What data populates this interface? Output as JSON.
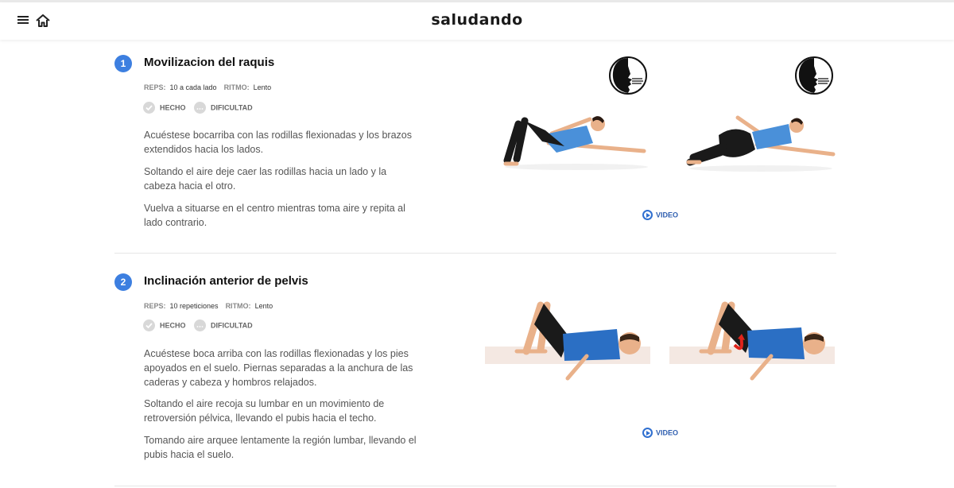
{
  "header": {
    "logo_text": "saludando",
    "icons": [
      "menu-icon",
      "home-icon"
    ]
  },
  "exercises": [
    {
      "number": "1",
      "title": "Movilizacion del raquis",
      "reps_label": "REPS:",
      "reps_value": "10 a cada lado",
      "rhythm_label": "RITMO:",
      "rhythm_value": "Lento",
      "done_label": "HECHO",
      "difficulty_label": "DIFICULTAD",
      "paragraphs": [
        "Acuéstese bocarriba con las rodillas flexionadas y los brazos extendidos hacia los lados.",
        "Soltando el aire deje caer las rodillas hacia un lado y la cabeza hacia el otro.",
        "Vuelva a situarse en el centro mientras toma aire y repita al lado contrario."
      ],
      "video_label": "VIDEO",
      "breathing_icons": [
        "exhale-icon",
        "exhale-icon"
      ]
    },
    {
      "number": "2",
      "title": "Inclinación anterior de pelvis",
      "reps_label": "REPS:",
      "reps_value": "10 repeticiones",
      "rhythm_label": "RITMO:",
      "rhythm_value": "Lento",
      "done_label": "HECHO",
      "difficulty_label": "DIFICULTAD",
      "paragraphs": [
        "Acuéstese boca arriba con las rodillas flexionadas y los pies apoyados en el suelo. Piernas separadas a la anchura de las caderas y cabeza y hombros relajados.",
        "Soltando el aire recoja su lumbar en un movimiento de retroversión pélvica, llevando el pubis hacia el techo.",
        "Tomando aire arquee lentamente la región lumbar, llevando el pubis hacia el suelo."
      ],
      "video_label": "VIDEO"
    }
  ],
  "colors": {
    "number_badge": "#3d7fe0",
    "video_link": "#2f5fb0",
    "shirt_light": "#4a90d9",
    "shirt_dark": "#2b6fc4",
    "shorts": "#1a1a1a",
    "skin": "#e9b18a",
    "pelvis_arrow": "#e0241b"
  }
}
